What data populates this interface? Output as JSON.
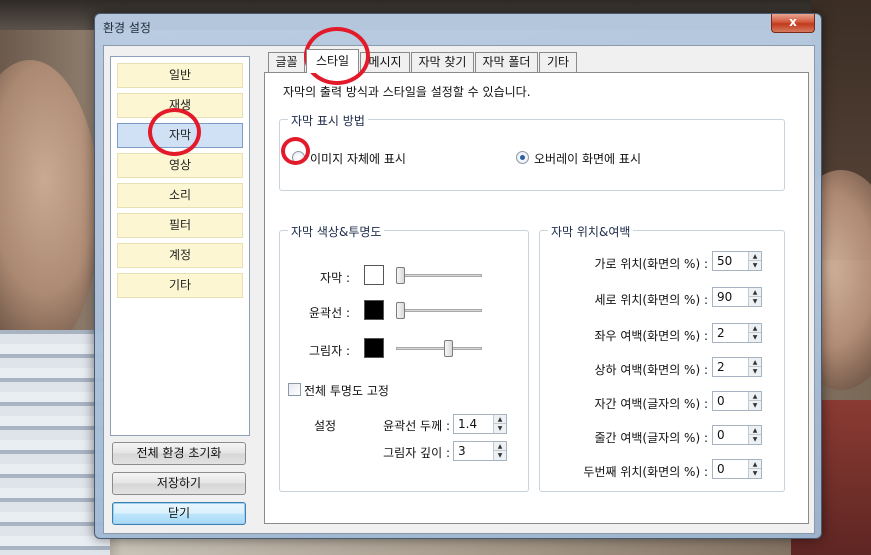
{
  "window": {
    "title": "환경 설정",
    "close_label": "x"
  },
  "sidebar": {
    "items": [
      {
        "label": "일반",
        "active": false
      },
      {
        "label": "재생",
        "active": false
      },
      {
        "label": "자막",
        "active": true
      },
      {
        "label": "영상",
        "active": false
      },
      {
        "label": "소리",
        "active": false
      },
      {
        "label": "필터",
        "active": false
      },
      {
        "label": "계정",
        "active": false
      },
      {
        "label": "기타",
        "active": false
      }
    ],
    "buttons": {
      "reset": "전체 환경 초기화",
      "save": "저장하기",
      "close": "닫기"
    }
  },
  "tabs": [
    {
      "label": "글꼴",
      "active": false
    },
    {
      "label": "스타일",
      "active": true
    },
    {
      "label": "메시지",
      "active": false
    },
    {
      "label": "자막 찾기",
      "active": false
    },
    {
      "label": "자막 폴더",
      "active": false
    },
    {
      "label": "기타",
      "active": false
    }
  ],
  "content": {
    "description": "자막의 출력 방식과 스타일을 설정할 수 있습니다.",
    "display_method": {
      "title": "자막 표시 방법",
      "option_image": "이미지 자체에 표시",
      "option_overlay": "오버레이 화면에 표시",
      "selected": "overlay"
    },
    "color_opacity": {
      "title": "자막 색상&투명도",
      "rows": [
        {
          "label": "자막 :",
          "color": "#ffffff",
          "opacity": 0.0
        },
        {
          "label": "윤곽선 :",
          "color": "#000000",
          "opacity": 0.0
        },
        {
          "label": "그림자 :",
          "color": "#000000",
          "opacity": 0.6
        }
      ],
      "fix_opacity_label": "전체 투명도 고정",
      "fix_opacity_checked": false,
      "settings_label": "설정",
      "outline_thickness_label": "윤곽선 두께 :",
      "outline_thickness_value": "1.4",
      "shadow_depth_label": "그림자 깊이 :",
      "shadow_depth_value": "3"
    },
    "position_margin": {
      "title": "자막 위치&여백",
      "rows": [
        {
          "label": "가로 위치(화면의 %) :",
          "value": "50"
        },
        {
          "label": "세로 위치(화면의 %) :",
          "value": "90"
        },
        {
          "label": "좌우 여백(화면의 %) :",
          "value": "2"
        },
        {
          "label": "상하 여백(화면의 %) :",
          "value": "2"
        },
        {
          "label": "자간 여백(글자의 %) :",
          "value": "0"
        },
        {
          "label": "줄간 여백(글자의 %) :",
          "value": "0"
        },
        {
          "label": "두번째 위치(화면의 %) :",
          "value": "0"
        }
      ]
    }
  },
  "colors": {
    "annotation": "#e31a2a",
    "active_nav": "#d0e0f5",
    "nav_bg": "#fdf6d2"
  }
}
